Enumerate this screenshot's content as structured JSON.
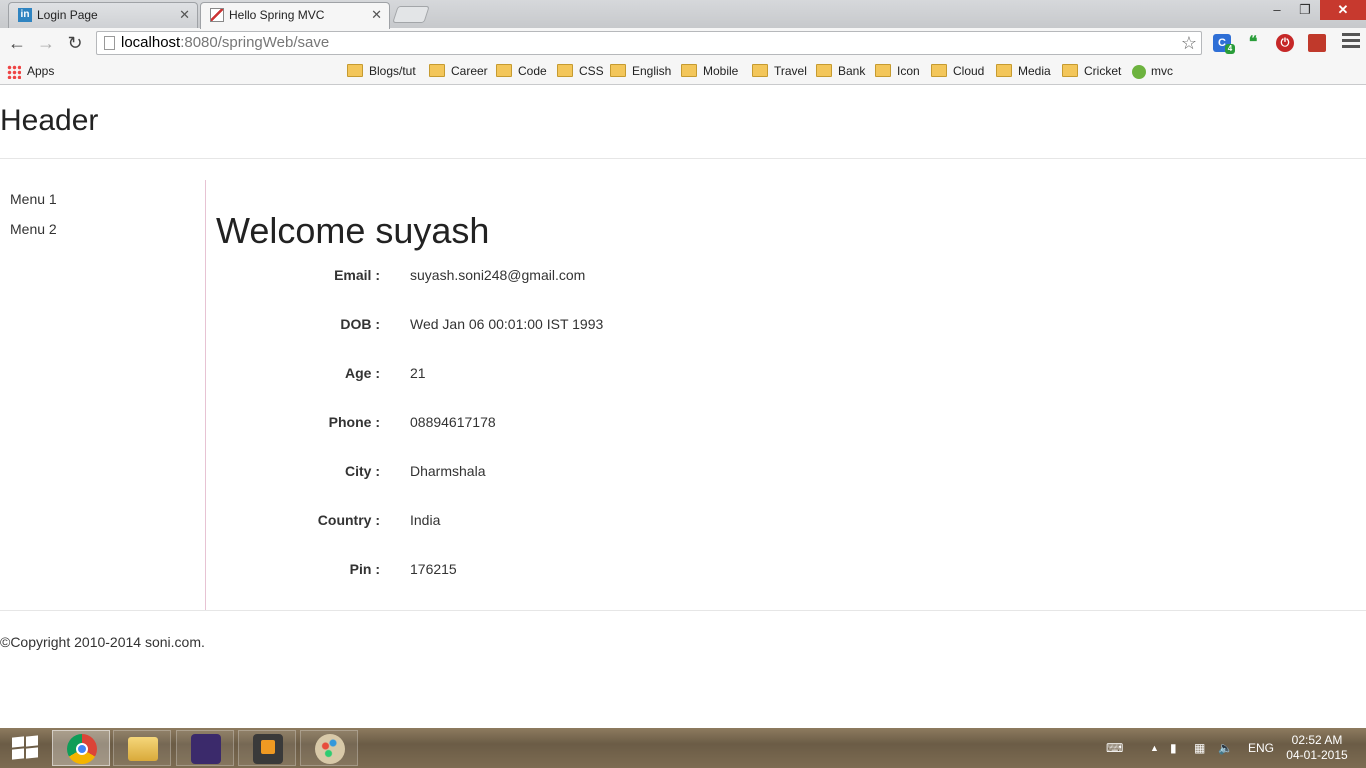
{
  "browser": {
    "tabs": [
      {
        "label": "Login Page",
        "active": false
      },
      {
        "label": "Hello Spring MVC",
        "active": true
      }
    ],
    "address": {
      "host": "localhost",
      "rest": ":8080/springWeb/save"
    },
    "bookmarks": [
      "Apps",
      "Blogs/tut",
      "Career",
      "Code",
      "CSS",
      "English",
      "Mobile",
      "Travel",
      "Bank",
      "Icon",
      "Cloud",
      "Media",
      "Cricket",
      "mvc"
    ],
    "extension_badge": "4"
  },
  "page": {
    "header": "Header",
    "menu": [
      "Menu 1",
      "Menu 2"
    ],
    "welcome": "Welcome suyash",
    "fields": [
      {
        "label": "Email :",
        "value": "suyash.soni248@gmail.com"
      },
      {
        "label": "DOB :",
        "value": "Wed Jan 06 00:01:00 IST 1993"
      },
      {
        "label": "Age :",
        "value": "21"
      },
      {
        "label": "Phone :",
        "value": "08894617178"
      },
      {
        "label": "City :",
        "value": "Dharmshala"
      },
      {
        "label": "Country :",
        "value": "India"
      },
      {
        "label": "Pin :",
        "value": "176215"
      }
    ],
    "footer": "©Copyright 2010-2014 soni.com."
  },
  "taskbar": {
    "language": "ENG",
    "time": "02:52 AM",
    "date": "04-01-2015",
    "apps": [
      "chrome-icon",
      "file-explorer-icon",
      "java-ee-ide-icon",
      "sublime-text-icon",
      "paint-icon"
    ]
  }
}
